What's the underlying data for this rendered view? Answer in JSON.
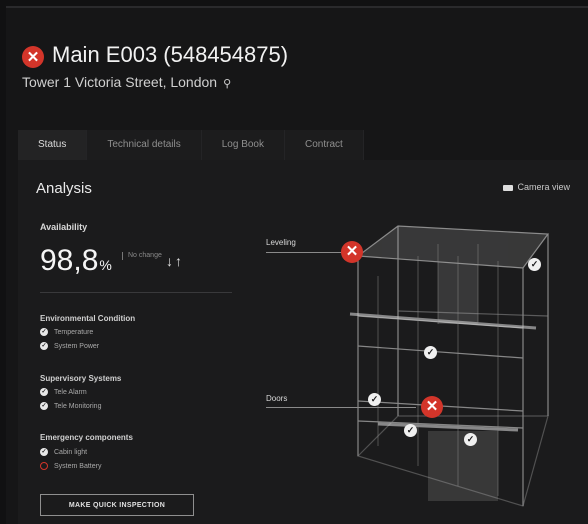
{
  "header": {
    "title": "Main E003 (548454875)",
    "address": "Tower 1 Victoria Street, London"
  },
  "tabs": [
    {
      "label": "Status"
    },
    {
      "label": "Technical details"
    },
    {
      "label": "Log Book"
    },
    {
      "label": "Contract"
    }
  ],
  "panel": {
    "title": "Analysis",
    "camera_view": "Camera view"
  },
  "availability": {
    "label": "Availability",
    "value": "98,8",
    "unit": "%",
    "change_note": "No change",
    "trend": "↓↑"
  },
  "sections": {
    "environmental": {
      "title": "Environmental Condition",
      "items": [
        {
          "label": "Temperature",
          "status": "ok"
        },
        {
          "label": "System Power",
          "status": "ok"
        }
      ]
    },
    "supervisory": {
      "title": "Supervisory Systems",
      "items": [
        {
          "label": "Tele Alarm",
          "status": "ok"
        },
        {
          "label": "Tele Monitoring",
          "status": "ok"
        }
      ]
    },
    "emergency": {
      "title": "Emergency components",
      "items": [
        {
          "label": "Cabin light",
          "status": "ok"
        },
        {
          "label": "System Battery",
          "status": "fault"
        }
      ]
    }
  },
  "actions": {
    "inspection": "MAKE QUICK INSPECTION"
  },
  "model": {
    "callouts": {
      "leveling": "Leveling",
      "doors": "Doors"
    }
  },
  "colors": {
    "fault": "#d3352a",
    "ok": "#f0f0f0",
    "background": "#161617"
  }
}
